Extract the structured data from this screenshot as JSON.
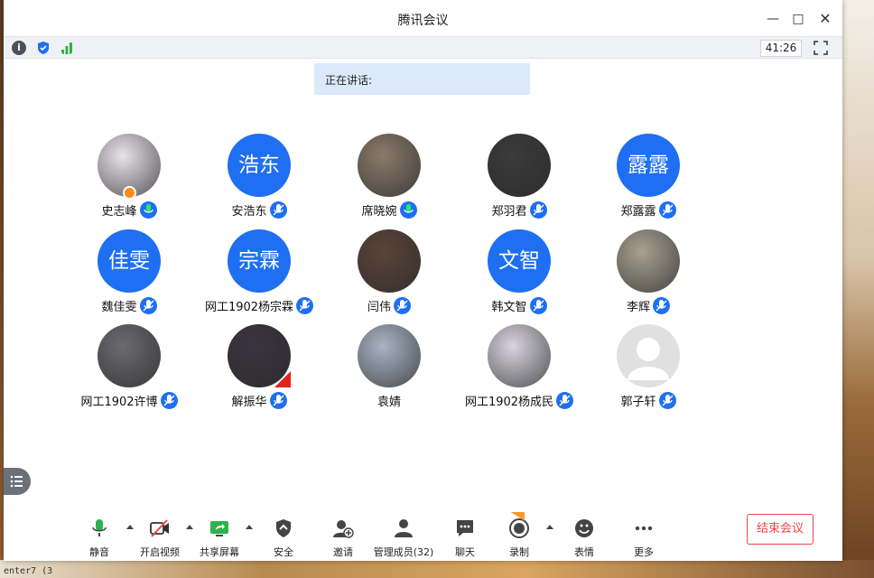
{
  "window": {
    "title": "腾讯会议"
  },
  "toolbar": {
    "timer": "41:26"
  },
  "speaking": {
    "label": "正在讲话:"
  },
  "participants": [
    {
      "name": "史志峰",
      "avatar_text": "",
      "avatar_color": "#e9e3ea",
      "mic": "active",
      "host": true
    },
    {
      "name": "安浩东",
      "avatar_text": "浩东",
      "avatar_color": "#1e6ff1",
      "mic": "muted"
    },
    {
      "name": "席晓婉",
      "avatar_text": "",
      "avatar_color": "#8a7a6a",
      "mic": "active"
    },
    {
      "name": "郑羽君",
      "avatar_text": "",
      "avatar_color": "#3a3a3a",
      "mic": "muted"
    },
    {
      "name": "郑露露",
      "avatar_text": "露露",
      "avatar_color": "#1e6ff1",
      "mic": "muted"
    },
    {
      "name": "魏佳雯",
      "avatar_text": "佳雯",
      "avatar_color": "#1e6ff1",
      "mic": "muted"
    },
    {
      "name": "网工1902杨宗霖",
      "avatar_text": "宗霖",
      "avatar_color": "#1e6ff1",
      "mic": "muted"
    },
    {
      "name": "闫伟",
      "avatar_text": "",
      "avatar_color": "#5a4438",
      "mic": "muted"
    },
    {
      "name": "韩文智",
      "avatar_text": "文智",
      "avatar_color": "#1e6ff1",
      "mic": "muted"
    },
    {
      "name": "李辉",
      "avatar_text": "",
      "avatar_color": "#a8a090",
      "mic": "muted"
    },
    {
      "name": "网工1902许博",
      "avatar_text": "",
      "avatar_color": "#6a6a70",
      "mic": "muted"
    },
    {
      "name": "解振华",
      "avatar_text": "",
      "avatar_color": "#3a3440",
      "mic": "muted",
      "flag": true
    },
    {
      "name": "袁婧",
      "avatar_text": "",
      "avatar_color": "#a8b4c4",
      "mic": "none"
    },
    {
      "name": "网工1902杨成民",
      "avatar_text": "",
      "avatar_color": "#d8d4e0",
      "mic": "muted"
    },
    {
      "name": "郭子轩",
      "avatar_text": "",
      "avatar_color": "#e0e0e0",
      "mic": "muted",
      "default_avatar": true
    }
  ],
  "bottom": {
    "mute": "静音",
    "video": "开启视频",
    "share": "共享屏幕",
    "security": "安全",
    "invite": "邀请",
    "members": "管理成员(32)",
    "chat": "聊天",
    "record": "录制",
    "reactions": "表情",
    "more": "更多",
    "end": "结束会议",
    "new_tag": "new"
  },
  "desktop": {
    "fragment": "enter7 (3"
  },
  "colors": {
    "accent": "#1e6ff1",
    "end": "#e64646",
    "host": "#ff8a1c"
  }
}
